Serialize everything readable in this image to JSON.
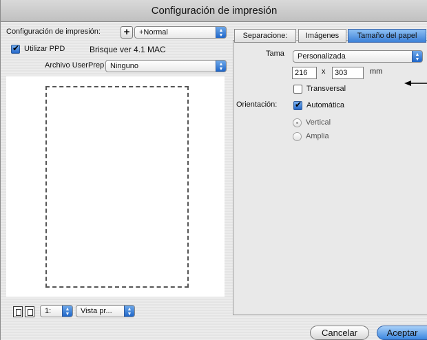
{
  "window": {
    "title": "Configuración de impresión"
  },
  "left": {
    "config_label": "Configuración de impresión:",
    "config_add_glyph": "+",
    "config_value": "+Normal",
    "use_ppd_label": "Utilizar PPD",
    "use_ppd_checked": true,
    "ppd_name": "Brisque ver 4.1 MAC",
    "userprep_label": "Archivo UserPrep",
    "userprep_value": "Ninguno",
    "page_value": "1:",
    "view_value": "Vista pr..."
  },
  "tabs": [
    {
      "label": "Separacione:",
      "active": false
    },
    {
      "label": "Imágenes",
      "active": false
    },
    {
      "label": "Tamaño del papel",
      "active": true
    }
  ],
  "paper": {
    "size_label": "Tama",
    "size_value": "Personalizada",
    "width": "216",
    "times": "x",
    "height": "303",
    "unit": "mm",
    "transverse_label": "Transversal",
    "transverse_checked": false,
    "orientation_label": "Orientación:",
    "automatic_label": "Automática",
    "automatic_checked": true,
    "vertical_label": "Vertical",
    "wide_label": "Amplia",
    "selected_orientation": "Vertical"
  },
  "buttons": {
    "cancel": "Cancelar",
    "accept": "Aceptar"
  },
  "icons": {
    "popup_arrows": "updown-arrows-icon",
    "callout": "callout-arrow-icon",
    "prev_page": "prev-page-icon",
    "next_page": "next-page-icon"
  }
}
